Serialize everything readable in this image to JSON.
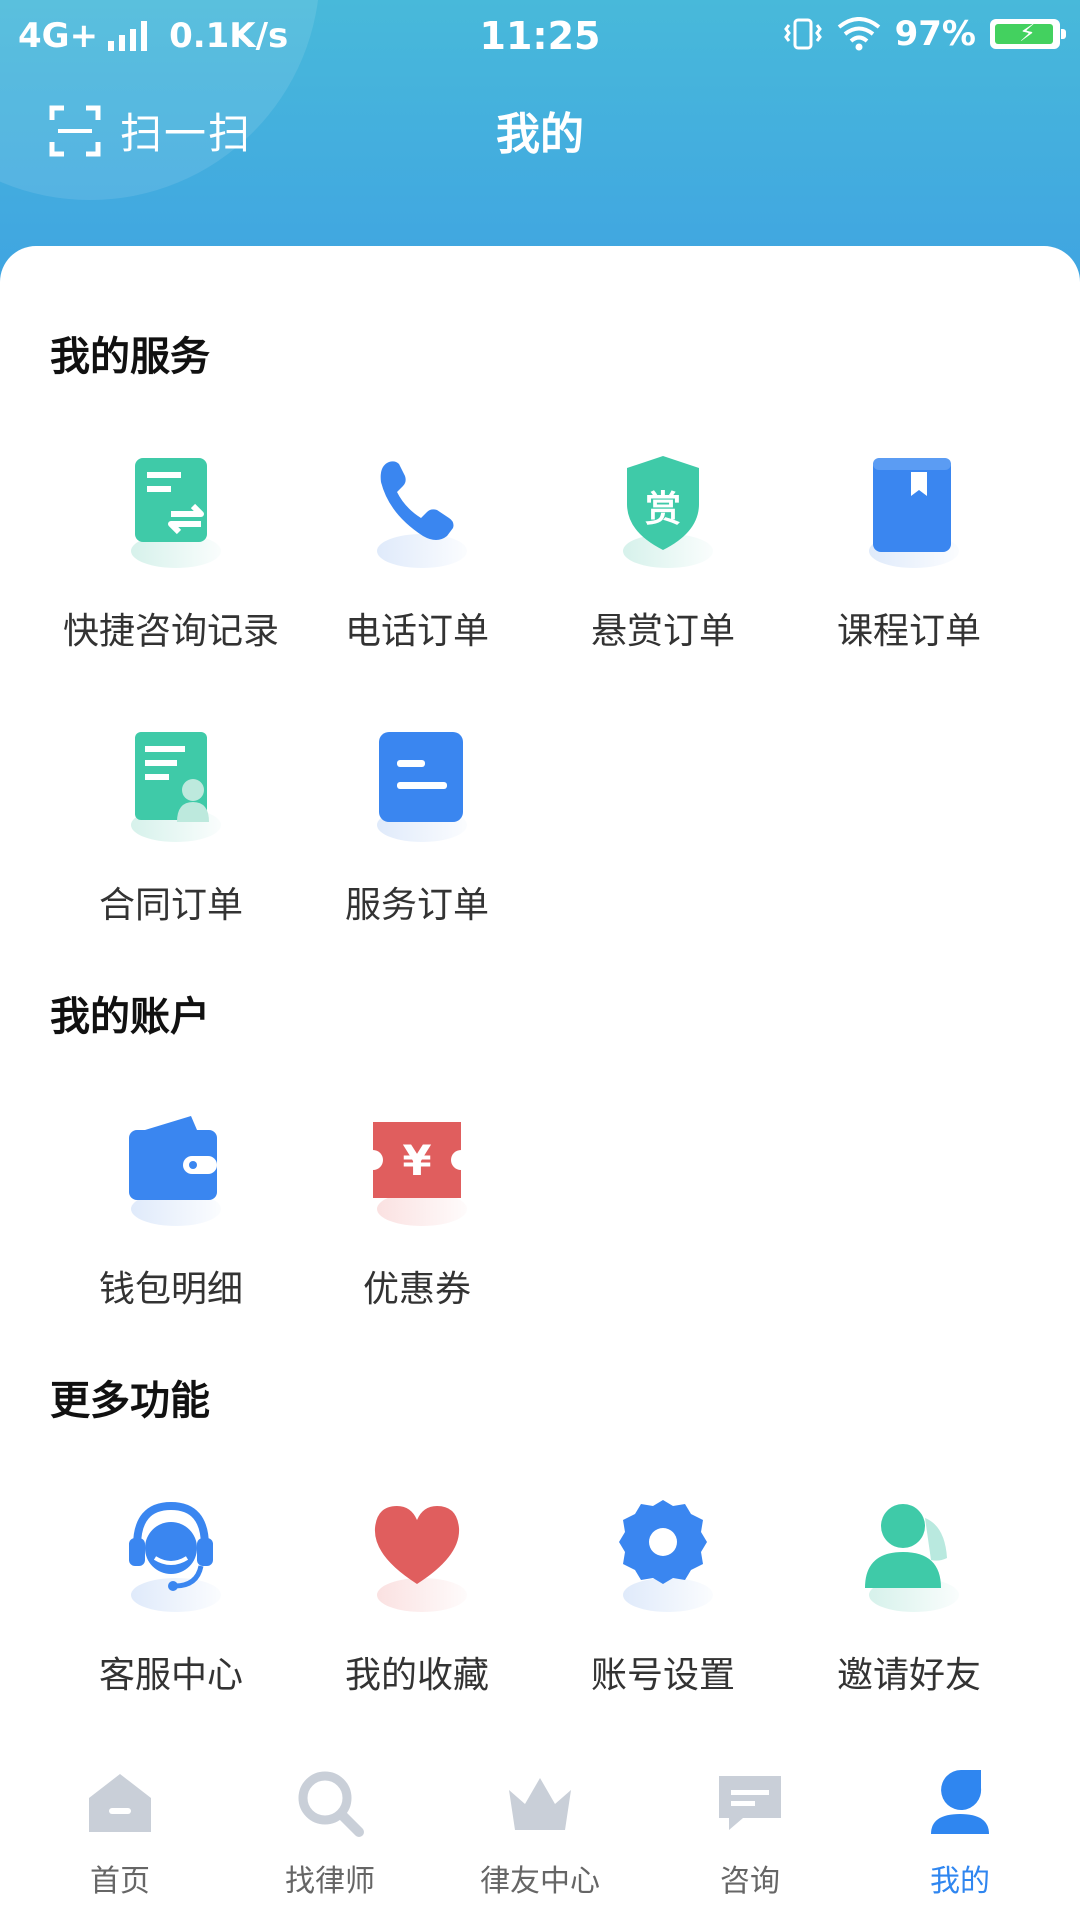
{
  "status_bar": {
    "network": "4G+",
    "speed": "0.1K/s",
    "time": "11:25",
    "battery": "97%"
  },
  "header": {
    "scan_label": "扫一扫",
    "title": "我的"
  },
  "sections": {
    "services": {
      "title": "我的服务",
      "items": [
        {
          "label": "快捷咨询记录",
          "icon": "quick-consult-record-icon"
        },
        {
          "label": "电话订单",
          "icon": "phone-icon"
        },
        {
          "label": "悬赏订单",
          "icon": "reward-shield-icon"
        },
        {
          "label": "课程订单",
          "icon": "course-book-icon"
        },
        {
          "label": "合同订单",
          "icon": "contract-icon"
        },
        {
          "label": "服务订单",
          "icon": "service-order-icon"
        }
      ],
      "reward_char": "赏"
    },
    "account": {
      "title": "我的账户",
      "items": [
        {
          "label": "钱包明细",
          "icon": "wallet-icon"
        },
        {
          "label": "优惠券",
          "icon": "coupon-icon"
        }
      ],
      "coupon_char": "¥"
    },
    "more": {
      "title": "更多功能",
      "items": [
        {
          "label": "客服中心",
          "icon": "customer-service-icon"
        },
        {
          "label": "我的收藏",
          "icon": "heart-icon"
        },
        {
          "label": "账号设置",
          "icon": "gear-icon"
        },
        {
          "label": "邀请好友",
          "icon": "invite-friends-icon"
        }
      ]
    }
  },
  "tabbar": {
    "items": [
      {
        "label": "首页",
        "icon": "home-icon"
      },
      {
        "label": "找律师",
        "icon": "search-icon"
      },
      {
        "label": "律友中心",
        "icon": "crown-icon"
      },
      {
        "label": "咨询",
        "icon": "chat-icon"
      },
      {
        "label": "我的",
        "icon": "user-icon",
        "active": true
      }
    ]
  },
  "colors": {
    "header_top": "#48b9da",
    "header_bottom": "#3fa3e2",
    "green": "#3fcaa8",
    "blue": "#3a86f0",
    "red": "#e05e5e",
    "tab_active": "#2f86f0",
    "tab_inactive": "#c9cfd8"
  }
}
